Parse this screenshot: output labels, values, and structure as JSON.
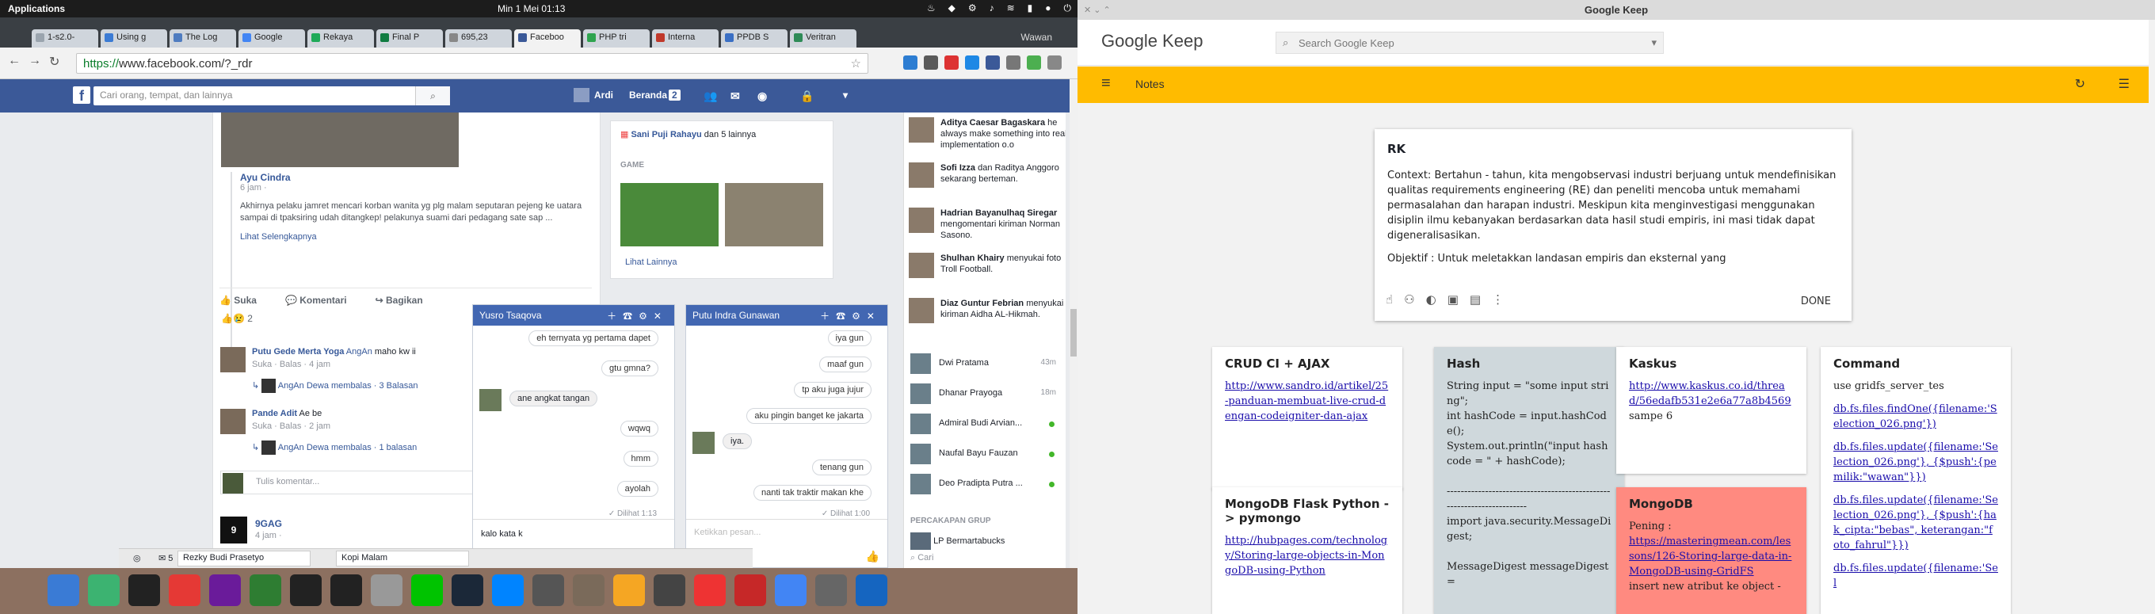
{
  "topbar": {
    "apps": "Applications",
    "clock": "Min  1 Mei  01:13"
  },
  "browser": {
    "tabs": [
      {
        "label": "1-s2.0-",
        "color": "#9aa4ae"
      },
      {
        "label": "Using g",
        "color": "#3b7bd4"
      },
      {
        "label": "The Log",
        "color": "#4f7cc0"
      },
      {
        "label": "Google",
        "color": "#4285f4"
      },
      {
        "label": "Rekaya",
        "color": "#1faa59"
      },
      {
        "label": "Final P",
        "color": "#107c41"
      },
      {
        "label": "695,23",
        "color": "#888"
      },
      {
        "label": "Faceboo",
        "color": "#3b5998"
      },
      {
        "label": "PHP tri",
        "color": "#2ea44f"
      },
      {
        "label": "Interna",
        "color": "#c0392b"
      },
      {
        "label": "PPDB S",
        "color": "#3a6fc4"
      },
      {
        "label": "Veritran",
        "color": "#2e8b57"
      }
    ],
    "user": "Wawan",
    "url_secure": "https://",
    "url_rest": "www.facebook.com/?_rdr"
  },
  "facebook": {
    "search_placeholder": "Cari orang, tempat, dan lainnya",
    "nav_user": "Ardi",
    "nav_home": "Beranda",
    "nav_home_count": "2",
    "post1": {
      "author": "Ayu Cindra",
      "time": "6 jam ·",
      "text": "Akhirnya pelaku jamret mencari korban wanita yg plg malam seputaran pejeng ke uatara sampai di tpaksiring udah ditangkep! pelakunya suami dari pedagang sate sap ...",
      "more": "Lihat Selengkapnya",
      "like": "Suka",
      "comment": "Komentari",
      "share": "Bagikan",
      "reactions": "2"
    },
    "comments": [
      {
        "name": "Putu Gede Merta Yoga",
        "tag": "AngAn",
        "text": "maho kw ii",
        "meta": "Suka · Balas · 4 jam",
        "reply": "AngAn Dewa membalas · 3 Balasan"
      },
      {
        "name": "Pande Adit",
        "tag": "",
        "text": "Ae be",
        "meta": "Suka · Balas · 2 jam",
        "reply": "AngAn Dewa membalas · 1 balasan"
      }
    ],
    "comment_placeholder": "Tulis komentar...",
    "next_post": "9GAG",
    "next_post_time": "4 jam ·",
    "game_card": {
      "actor": "Sani Puji Rahayu",
      "suffix": "dan 5 lainnya",
      "label": "GAME",
      "more": "Lihat Lainnya"
    },
    "chat1": {
      "name": "Yusro Tsaqova",
      "messages": [
        {
          "text": "eh ternyata yg pertama dapet",
          "me": true
        },
        {
          "text": "gtu gmna?",
          "me": true
        },
        {
          "text": "ane angkat tangan",
          "me": false
        },
        {
          "text": "wqwq",
          "me": true
        },
        {
          "text": "hmm",
          "me": true
        },
        {
          "text": "ayolah",
          "me": true
        }
      ],
      "seen": "✓ Dilihat 1:13",
      "draft": "kalo kata k"
    },
    "chat2": {
      "name": "Putu Indra Gunawan",
      "messages": [
        {
          "text": "iya gun",
          "me": true
        },
        {
          "text": "maaf gun",
          "me": true
        },
        {
          "text": "tp aku juga jujur",
          "me": true
        },
        {
          "text": "aku pingin banget ke jakarta",
          "me": true
        },
        {
          "text": "iya.",
          "me": false
        },
        {
          "text": "tenang gun",
          "me": true
        },
        {
          "text": "nanti tak traktir makan khe",
          "me": true
        }
      ],
      "seen": "✓ Dilihat 1:00",
      "placeholder": "Ketikkan pesan..."
    },
    "ticker": [
      {
        "name": "Aditya Caesar Bagaskara",
        "text": "he always make something into real implementation o.o"
      },
      {
        "name": "Sofi Izza",
        "text": "dan Raditya Anggoro sekarang berteman."
      },
      {
        "name": "Hadrian Bayanulhaq Siregar",
        "text": "mengomentari kiriman Norman Sasono."
      },
      {
        "name": "Shulhan Khairy",
        "text": "menyukai foto Troll Football."
      },
      {
        "name": "Diaz Guntur Febrian",
        "text": "menyukai kiriman Aidha AL-Hikmah."
      }
    ],
    "contacts": [
      {
        "name": "Dwi Pratama",
        "status": "43m"
      },
      {
        "name": "Dhanar Prayoga",
        "status": "18m"
      },
      {
        "name": "Admiral Budi Arvian...",
        "status": ""
      },
      {
        "name": "Naufal Bayu Fauzan",
        "status": ""
      },
      {
        "name": "Deo Pradipta Putra ...",
        "status": ""
      }
    ],
    "groups_header": "PERCAKAPAN GRUP",
    "group": "LP Bermartabucks",
    "sidebar_search": "Cari",
    "bottom_chats": [
      "Rezky Budi Prasetyo",
      "Kopi Malam"
    ],
    "bottom_count": "5"
  },
  "keep": {
    "window_title": "Google Keep",
    "logo": "Google Keep",
    "search_placeholder": "Search Google Keep",
    "toolbar_title": "Notes",
    "editor": {
      "title": "RK",
      "body1": "Context: Bertahun - tahun, kita mengobservasi industri berjuang untuk mendefinisikan qualitas requirements engineering (RE) dan peneliti mencoba untuk memahami permasalahan dan harapan industri. Meskipun kita menginvestigasi menggunakan disiplin ilmu kebanyakan berdasarkan data hasil studi empiris, ini masi tidak dapat digeneralisasikan.",
      "body2": "Objektif : Untuk meletakkan landasan empiris dan eksternal yang",
      "done": "DONE"
    },
    "cards": [
      {
        "title": "CRUD CI + AJAX",
        "link": "http://www.sandro.id/artikel/25-panduan-membuat-live-crud-dengan-codeigniter-dan-ajax",
        "text": "",
        "bg": "#ffffff"
      },
      {
        "title": "MongoDB Flask Python -> pymongo",
        "link": "http://hubpages.com/technology/Storing-large-objects-in-MongoDB-using-Python",
        "text": "",
        "bg": "#ffffff"
      },
      {
        "title": "Hash",
        "link": "",
        "text": "String input = \"some input string\";\nint hashCode = input.hashCode();\nSystem.out.println(\"input hash code = \" + hashCode);\n\n----------------------------------------------------------------------\nimport java.security.MessageDigest;\n\nMessageDigest messageDigest =",
        "bg": "#cfd8dc"
      },
      {
        "title": "Kaskus",
        "link": "http://www.kaskus.co.id/thread/56edafb531e2e6a77a8b4569",
        "text": "sampe 6",
        "bg": "#ffffff"
      },
      {
        "title": "MongoDB",
        "link": "https://masteringmean.com/lessons/126-Storing-large-data-in-MongoDB-using-GridFS",
        "text": "insert new atribut ke object -",
        "prefix": "Pening :",
        "bg": "#ff8a80"
      },
      {
        "title": "Command",
        "link": "",
        "text": "use gridfs_server_tes",
        "bg": "#ffffff",
        "lines": [
          "db.fs.files.findOne({filename:'Selection_026.png'})",
          "db.fs.files.update({filename:'Selection_026.png'}, {$push':{pemilik:\"wawan\"}})",
          "db.fs.files.update({filename:'Selection_026.png'}, {$push':{hak_cipta:\"bebas\", keterangan:\"foto_fahrul\"}})",
          "db.fs.files.update({filename:'Sel"
        ]
      }
    ]
  }
}
